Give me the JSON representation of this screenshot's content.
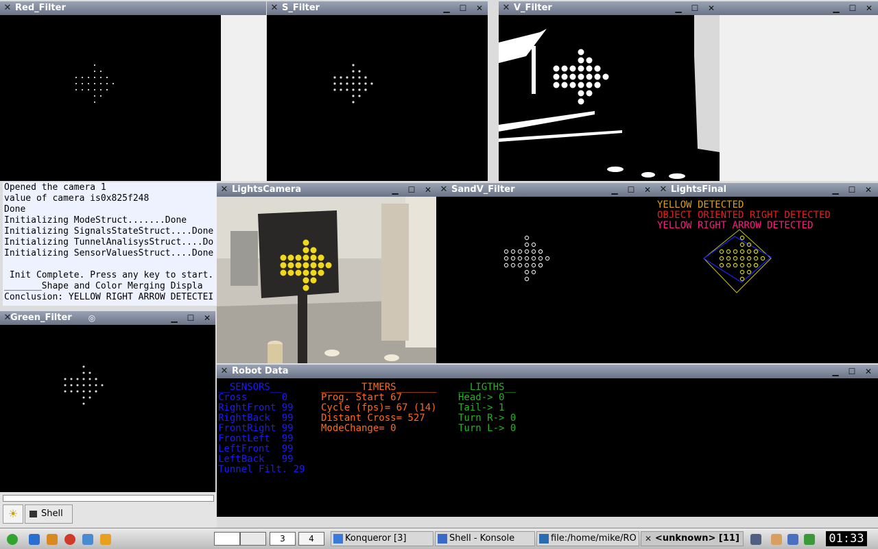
{
  "windows": {
    "red_filter": {
      "title": "Red_Filter"
    },
    "s_filter": {
      "title": "S_Filter"
    },
    "v_filter": {
      "title": "V_Filter"
    },
    "lights_camera": {
      "title": "LightsCamera"
    },
    "sandv_filter": {
      "title": "SandV_Filter"
    },
    "lights_final": {
      "title": "LightsFinal",
      "messages": [
        "YELLOW DETECTED",
        "OBJECT ORIENTED RIGHT DETECTED",
        "YELLOW RIGHT ARROW DETECTED"
      ]
    },
    "green_filter": {
      "title": "Green_Filter"
    },
    "robot_data": {
      "title": "Robot Data"
    }
  },
  "terminal": {
    "lines": [
      "Opened the camera 1",
      "value of camera is0x825f248",
      "Done",
      "Initializing ModeStruct.......Done",
      "Initializing SignalsStateStruct....Done",
      "Initializing TunnelAnalisysStruct....Do",
      "Initializing SensorValuesStruct....Done",
      "",
      " Init Complete. Press any key to start.",
      "_______Shape and Color Merging Displa",
      "Conclusion: YELLOW RIGHT ARROW DETECTEI"
    ]
  },
  "robot_data": {
    "sensors_header": "__SENSORS__",
    "sensors": [
      "Cross      0",
      "RightFront 99",
      "RightBack  99",
      "FrontRight 99",
      "FrontLeft  99",
      "LeftFront  99",
      "LeftBack   99",
      "Tunnel Filt. 29"
    ],
    "timers_header": "_______TIMERS_______",
    "timers": [
      "Prog. Start 67",
      "Cycle (fps)= 67 (14)",
      "Distant Cross= 527",
      "ModeChange= 0"
    ],
    "lights_header": "__LIGTHS__",
    "lights": [
      "Head-> 0",
      "Tail-> 1",
      "Turn R-> 0",
      "Turn L-> 0"
    ]
  },
  "shell_tab": {
    "label": "Shell"
  },
  "taskbar": {
    "desktop_current": "3",
    "desktop_4": "4",
    "tasks": [
      "Konqueror [3]",
      "Shell - Konsole",
      "file:/home/mike/RO",
      "<unknown> [11]"
    ],
    "clock": "01:33"
  },
  "colors": {
    "sensors": "#1a1aff",
    "timers": "#ff6a1a",
    "lights": "#22b522",
    "yellow_msg": "#e0a000",
    "red_msg": "#e02020",
    "pink_msg": "#ff1a80"
  },
  "icons": {
    "window_menu": "x-icon",
    "minimize": "minimize-icon",
    "maximize": "maximize-icon",
    "close": "close-icon"
  }
}
